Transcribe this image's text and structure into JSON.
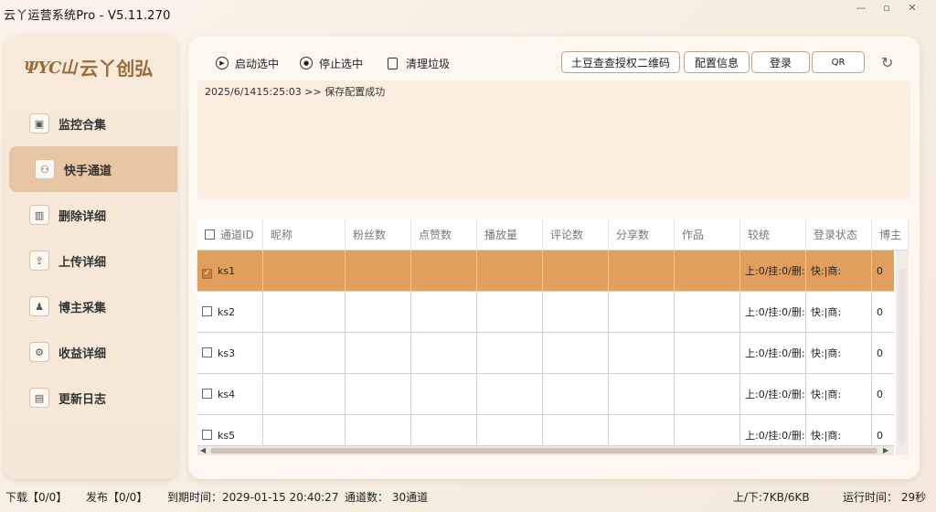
{
  "app": {
    "title": "云丫运营系统Pro - V5.11.270"
  },
  "window_controls": [
    "minimize-icon",
    "restore-icon",
    "close-icon"
  ],
  "logo": {
    "mark": "ΨYC山",
    "text": "云丫创弘"
  },
  "sidebar": {
    "items": [
      {
        "label": "监控合集",
        "icon": "monitor-icon"
      },
      {
        "label": "快手通道",
        "icon": "channel-icon",
        "active": true
      },
      {
        "label": "删除详细",
        "icon": "trash-icon"
      },
      {
        "label": "上传详细",
        "icon": "upload-icon"
      },
      {
        "label": "博主采集",
        "icon": "users-icon"
      },
      {
        "label": "收益详细",
        "icon": "revenue-icon"
      },
      {
        "label": "更新日志",
        "icon": "log-icon"
      }
    ]
  },
  "toolbar": {
    "start_label": "启动选中",
    "stop_label": "停止选中",
    "clean_label": "清理垃圾",
    "qr_auth_label": "土豆查查授权二维码",
    "config_label": "配置信息",
    "login_label": "登录",
    "qr_label": "QR"
  },
  "log": {
    "line": "2025/6/1415:25:03 >> 保存配置成功"
  },
  "table": {
    "columns": [
      "通道ID",
      "昵称",
      "粉丝数",
      "点赞数",
      "播放量",
      "评论数",
      "分享数",
      "作品",
      "较统",
      "登录状态",
      "博主"
    ],
    "rows": [
      {
        "id": "ks1",
        "stats": "上:0/挂:0/删:",
        "login": "快:|商:",
        "last": "0",
        "checked": true
      },
      {
        "id": "ks2",
        "stats": "上:0/挂:0/删:",
        "login": "快:|商:",
        "last": "0",
        "checked": false
      },
      {
        "id": "ks3",
        "stats": "上:0/挂:0/删:",
        "login": "快:|商:",
        "last": "0",
        "checked": false
      },
      {
        "id": "ks4",
        "stats": "上:0/挂:0/删:",
        "login": "快:|商:",
        "last": "0",
        "checked": false
      },
      {
        "id": "ks5",
        "stats": "上:0/挂:0/删:",
        "login": "快:|商:",
        "last": "0",
        "checked": false
      }
    ]
  },
  "status": {
    "download": "下载【0/0】",
    "publish": "发布【0/0】",
    "expire": "到期时间：2029-01-15 20:40:27",
    "channels": "通道数：  30通道",
    "traffic": "上/下:7KB/6KB",
    "runtime": "运行时间：  29秒"
  },
  "colors": {
    "accent": "#e19f5e",
    "nav_active": "#e7c6a3",
    "brand": "#9c6b35"
  }
}
